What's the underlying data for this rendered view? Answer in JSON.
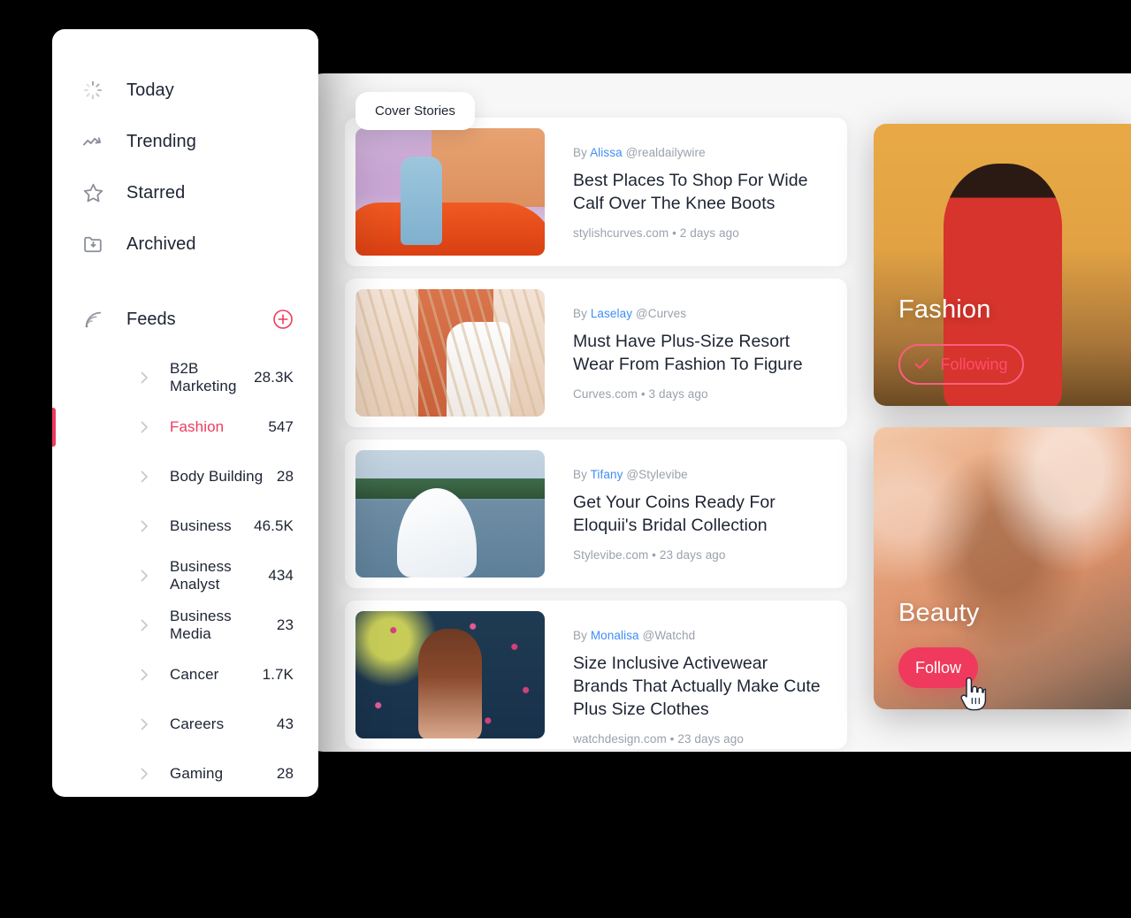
{
  "colors": {
    "accent": "#ef3a5d",
    "accent_light": "#ff4d6d",
    "link": "#3e8ef7",
    "text": "#1d2433",
    "muted": "#9aa1ac",
    "panel_bg": "#f7f7f8",
    "page_bg": "#000000"
  },
  "sidebar": {
    "nav": [
      {
        "label": "Today",
        "icon": "spinner-icon"
      },
      {
        "label": "Trending",
        "icon": "trending-up-icon"
      },
      {
        "label": "Starred",
        "icon": "star-icon"
      },
      {
        "label": "Archived",
        "icon": "archive-folder-icon"
      }
    ],
    "feeds": {
      "label": "Feeds",
      "icon": "rss-icon",
      "add_icon": "plus-circle-icon",
      "items": [
        {
          "name": "B2B Marketing",
          "count": "28.3K",
          "active": false
        },
        {
          "name": "Fashion",
          "count": "547",
          "active": true
        },
        {
          "name": "Body Building",
          "count": "28",
          "active": false
        },
        {
          "name": "Business",
          "count": "46.5K",
          "active": false
        },
        {
          "name": "Business Analyst",
          "count": "434",
          "active": false
        },
        {
          "name": "Business Media",
          "count": "23",
          "active": false
        },
        {
          "name": "Cancer",
          "count": "1.7K",
          "active": false
        },
        {
          "name": "Careers",
          "count": "43",
          "active": false
        },
        {
          "name": "Gaming",
          "count": "28",
          "active": false
        }
      ]
    }
  },
  "main": {
    "tooltip": "Cover Stories",
    "articles": [
      {
        "by_prefix": "By",
        "author": "Alissa",
        "handle": "@realdailywire",
        "title": "Best Places To Shop For Wide Calf Over The Knee Boots",
        "meta": "stylishcurves.com • 2 days ago",
        "thumb": "woman-leaning-on-orange-car-thumbnail"
      },
      {
        "by_prefix": "By",
        "author": "Laselay",
        "handle": "@Curves",
        "title": "Must Have Plus-Size Resort Wear From Fashion To Figure",
        "meta": "Curves.com • 3 days ago",
        "thumb": "woman-in-white-on-chair-thumbnail"
      },
      {
        "by_prefix": "By",
        "author": "Tifany",
        "handle": "@Stylevibe",
        "title": "Get Your Coins Ready For Eloquii's Bridal Collection",
        "meta": "Stylevibe.com • 23 days ago",
        "thumb": "bride-by-lake-thumbnail"
      },
      {
        "by_prefix": "By",
        "author": "Monalisa",
        "handle": "@Watchd",
        "title": "Size Inclusive Activewear Brands That Actually Make Cute Plus Size Clothes",
        "meta": "watchdesign.com • 23 days ago",
        "thumb": "woman-with-neon-sign-thumbnail"
      }
    ]
  },
  "categories": [
    {
      "label": "Fashion",
      "button_label": "Following",
      "button_state": "following",
      "button_icon": "check-icon",
      "image": "woman-in-red-dress-photo"
    },
    {
      "label": "Beauty",
      "button_label": "Follow",
      "button_state": "follow",
      "button_icon": "",
      "image": "closeup-beauty-face-photo"
    }
  ],
  "cursor": {
    "icon": "pointing-hand-cursor"
  }
}
